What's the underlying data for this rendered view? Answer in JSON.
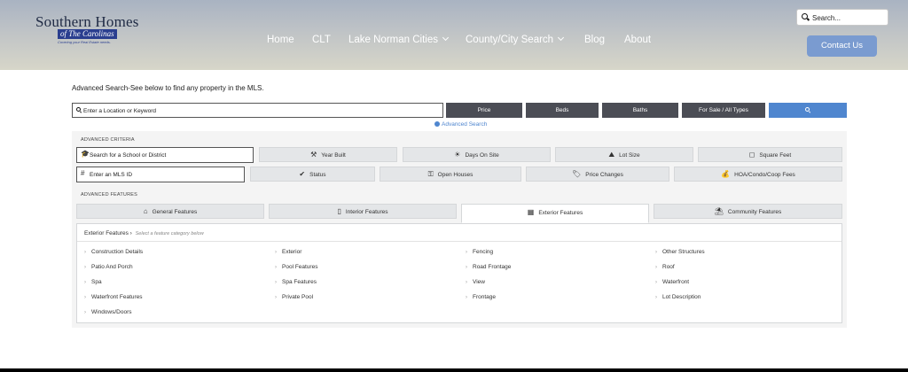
{
  "header": {
    "logo": {
      "line1": "Southern Homes",
      "line2": "of The Carolinas",
      "tagline": "Covering your Real Estate needs."
    },
    "nav": [
      {
        "label": "Home",
        "dropdown": false
      },
      {
        "label": "CLT",
        "dropdown": false
      },
      {
        "label": "Lake Norman Cities",
        "dropdown": true
      },
      {
        "label": "County/City Search",
        "dropdown": true
      },
      {
        "label": "Blog",
        "dropdown": false
      },
      {
        "label": "About",
        "dropdown": false
      }
    ],
    "search_placeholder": "Search...",
    "contact_label": "Contact Us"
  },
  "search": {
    "intro": "Advanced Search-See below to find any property in the MLS.",
    "location_placeholder": "Enter a Location or Keyword",
    "buttons": [
      "Price",
      "Beds",
      "Baths",
      "For Sale / All Types"
    ],
    "advanced_link": "Advanced Search"
  },
  "criteria": {
    "label": "ADVANCED CRITERIA",
    "school_placeholder": "Search for a School or District",
    "mls_placeholder": "Enter an MLS ID",
    "row1": [
      "Year Built",
      "Days On Site",
      "Lot Size",
      "Square Feet"
    ],
    "row2": [
      "Status",
      "Open Houses",
      "Price Changes",
      "HOA/Condo/Coop Fees"
    ]
  },
  "features": {
    "label": "ADVANCED FEATURES",
    "tabs": [
      "General Features",
      "Interior Features",
      "Exterior Features",
      "Community Features"
    ],
    "active_tab": "Exterior Features",
    "heading": "Exterior Features",
    "hint": "Select a feature category below",
    "items": [
      [
        "Construction Details",
        "Exterior",
        "Fencing",
        "Other Structures"
      ],
      [
        "Patio And Porch",
        "Pool Features",
        "Road Frontage",
        "Roof"
      ],
      [
        "Spa",
        "Spa Features",
        "View",
        "Waterfront"
      ],
      [
        "Waterfront Features",
        "Private Pool",
        "Frontage",
        "Lot Description"
      ],
      [
        "Windows/Doors"
      ]
    ]
  },
  "colors": {
    "accent": "#4f86cf",
    "contact": "#7a9bd0",
    "dark_button": "#4b4d55"
  }
}
